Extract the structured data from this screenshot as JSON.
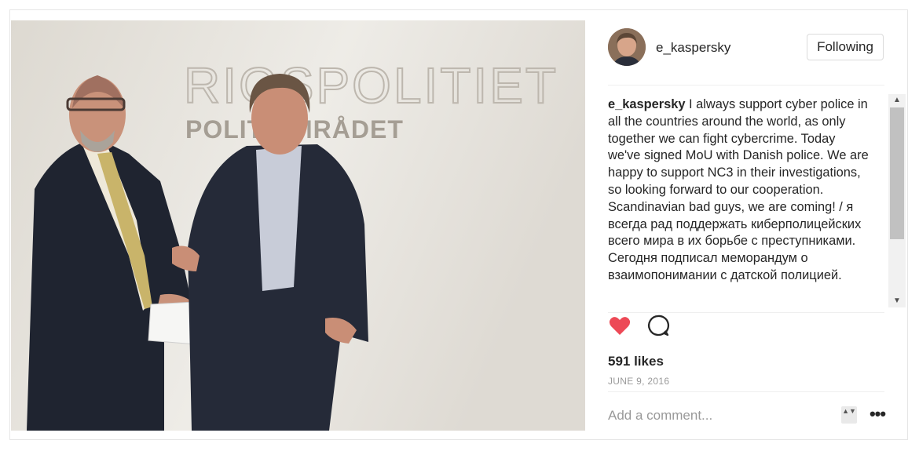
{
  "photo": {
    "sign_line1": "RIGSPOLITIET",
    "sign_line2": "POLITIOMRÅDET"
  },
  "header": {
    "username": "e_kaspersky",
    "follow_label": "Following"
  },
  "caption": {
    "username": "e_kaspersky",
    "text": " I always support cyber police in all the countries around the world, as only together we can fight cybercrime. Today we've signed MoU with Danish police. We are happy to support NC3 in their investigations, so looking forward to our cooperation. Scandinavian bad guys, we are coming! / я всегда рад поддержать киберполицейских всего мира в их борьбе с преступниками. Сегодня подписал меморандум о взаимопонимании с датской полицией."
  },
  "scrollbar": {
    "up_glyph": "▲",
    "down_glyph": "▼"
  },
  "stats": {
    "likes": "591 likes",
    "date": "JUNE 9, 2016"
  },
  "comment": {
    "placeholder": "Add a comment...",
    "resize_glyph": "▲▼",
    "more_glyph": "•••"
  },
  "icons": {
    "like": "heart-icon",
    "comment": "comment-icon",
    "like_color": "#ed4956"
  }
}
